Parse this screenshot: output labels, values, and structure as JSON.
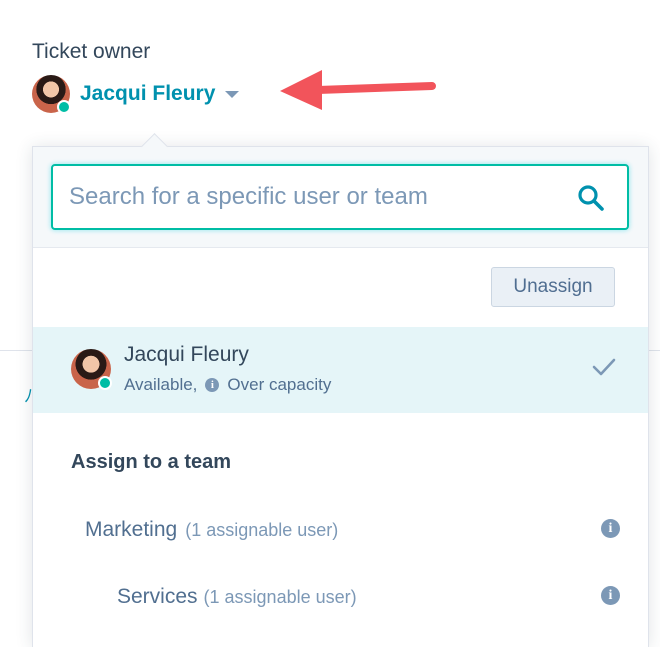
{
  "owner": {
    "label": "Ticket owner",
    "name": "Jacqui Fleury",
    "status_color": "#00bda5"
  },
  "annotation": {
    "arrow_color": "#f2545b",
    "icon": "arrow-left-icon"
  },
  "dropdown": {
    "search": {
      "placeholder": "Search for a specific user or team",
      "value": "",
      "icon": "search-icon"
    },
    "unassign_label": "Unassign",
    "selected_user": {
      "name": "Jacqui Fleury",
      "availability": "Available,",
      "capacity": "Over capacity",
      "selected": true,
      "highlight_color": "#e5f5f8"
    },
    "team_section": {
      "title": "Assign to a team",
      "teams": [
        {
          "name": "Marketing",
          "count": "(1 assignable user)"
        },
        {
          "name": "Services",
          "count": "(1 assignable user)"
        }
      ]
    }
  },
  "colors": {
    "accent": "#0091ae",
    "focus_border": "#00bda5",
    "text": "#33475b"
  }
}
